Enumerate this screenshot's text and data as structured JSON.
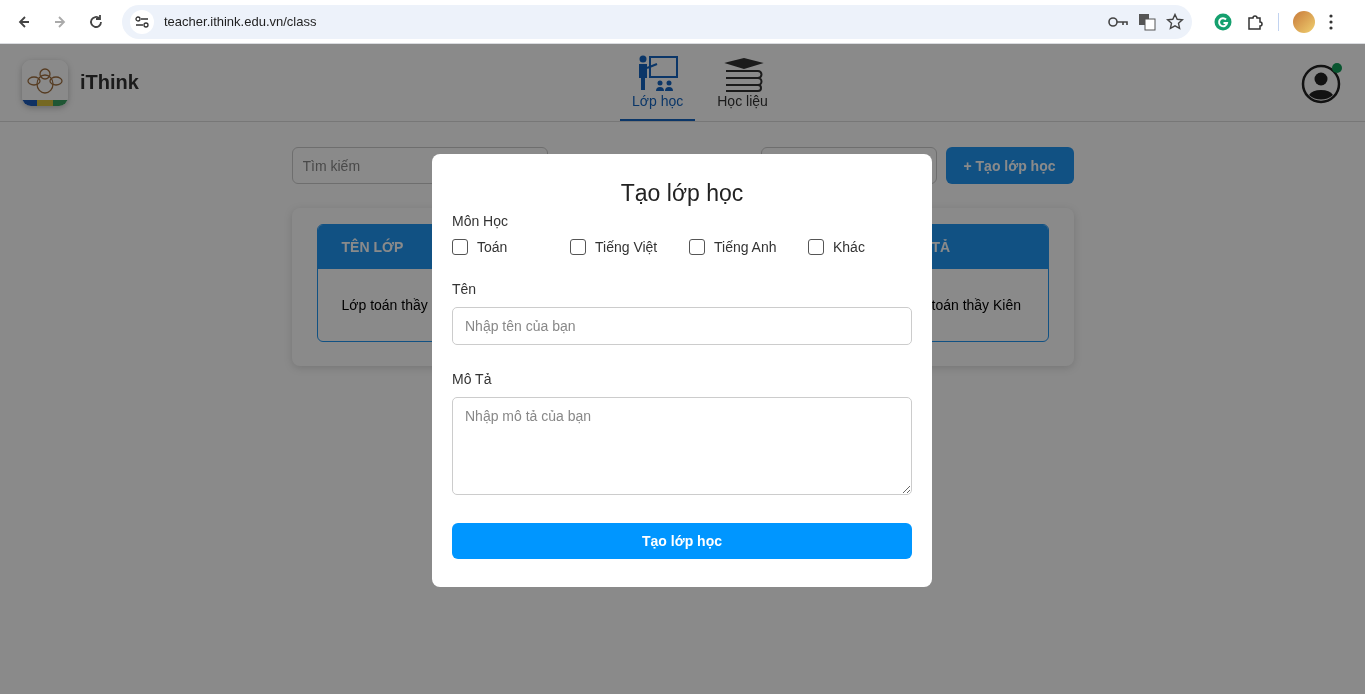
{
  "browser": {
    "url": "teacher.ithink.edu.vn/class"
  },
  "header": {
    "brand": "iThink",
    "nav": [
      {
        "label": "Lớp học",
        "selected": true
      },
      {
        "label": "Học liệu",
        "selected": false
      }
    ],
    "avatar_online": true
  },
  "toolbar": {
    "search_placeholder": "Tìm kiếm",
    "create_button": "+ Tạo lớp học"
  },
  "table": {
    "columns": [
      "TÊN LỚP",
      "TẢ"
    ],
    "rows": [
      [
        "Lớp toán thầy",
        "toán thầy Kiên"
      ]
    ]
  },
  "modal": {
    "title": "Tạo lớp học",
    "subject_label": "Môn Học",
    "subjects": [
      {
        "label": "Toán",
        "checked": false
      },
      {
        "label": "Tiếng Việt",
        "checked": false
      },
      {
        "label": "Tiếng Anh",
        "checked": false
      },
      {
        "label": "Khác",
        "checked": false
      }
    ],
    "name_label": "Tên",
    "name_placeholder": "Nhập tên của bạn",
    "desc_label": "Mô Tả",
    "desc_placeholder": "Nhập mô tả của bạn",
    "submit": "Tạo lớp học"
  }
}
